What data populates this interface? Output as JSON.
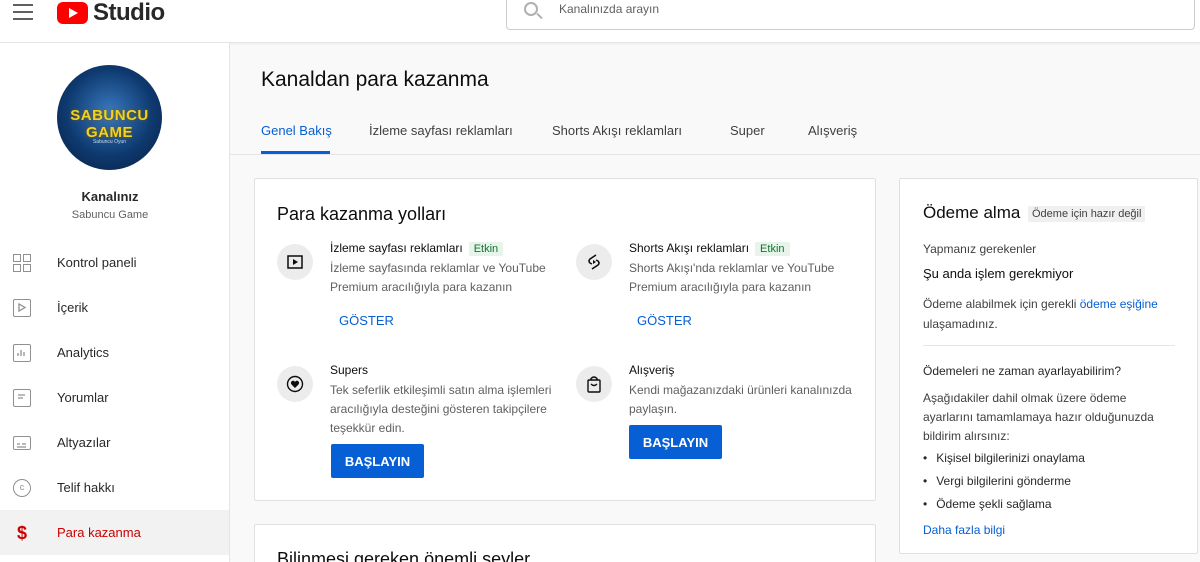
{
  "app": {
    "logo_text": "Studio"
  },
  "search": {
    "placeholder": "Kanalınızda arayın"
  },
  "channel": {
    "label": "Kanalınız",
    "name": "Sabuncu Game",
    "avatar_text": "SABUNCU GAME",
    "avatar_sub": "Sabuncu Oyun"
  },
  "sidebar": {
    "items": [
      {
        "label": "Kontrol paneli",
        "icon": "dashboard-icon"
      },
      {
        "label": "İçerik",
        "icon": "content-icon"
      },
      {
        "label": "Analytics",
        "icon": "analytics-icon"
      },
      {
        "label": "Yorumlar",
        "icon": "comments-icon"
      },
      {
        "label": "Altyazılar",
        "icon": "subtitles-icon"
      },
      {
        "label": "Telif hakkı",
        "icon": "copyright-icon"
      },
      {
        "label": "Para kazanma",
        "icon": "dollar-icon",
        "active": true
      }
    ]
  },
  "main": {
    "title": "Kanaldan para kazanma",
    "tabs": [
      {
        "label": "Genel Bakış",
        "active": true
      },
      {
        "label": "İzleme sayfası reklamları"
      },
      {
        "label": "Shorts Akışı reklamları"
      },
      {
        "label": "Super"
      },
      {
        "label": "Alışveriş"
      }
    ]
  },
  "ways": {
    "title": "Para kazanma yolları",
    "items": [
      {
        "title": "İzleme sayfası reklamları",
        "badge": "Etkin",
        "desc": "İzleme sayfasında reklamlar ve YouTube Premium aracılığıyla para kazanın",
        "action": "GÖSTER",
        "icon": "play-box-icon"
      },
      {
        "title": "Shorts Akışı reklamları",
        "badge": "Etkin",
        "desc": "Shorts Akışı'nda reklamlar ve YouTube Premium aracılığıyla para kazanın",
        "action": "GÖSTER",
        "icon": "shorts-icon"
      },
      {
        "title": "Supers",
        "desc": "Tek seferlik etkileşimli satın alma işlemleri aracılığıyla desteğini gösteren takipçilere teşekkür edin.",
        "action": "BAŞLAYIN",
        "icon": "supers-heart-icon"
      },
      {
        "title": "Alışveriş",
        "desc": "Kendi mağazanızdaki ürünleri kanalınızda paylaşın.",
        "action": "BAŞLAYIN",
        "icon": "shopping-bag-icon"
      }
    ]
  },
  "second_card": {
    "title_partial": "Bilinmesi gereken önemli şeyler"
  },
  "payment": {
    "title": "Ödeme alma",
    "status_badge": "Ödeme için hazır değil",
    "todo_label": "Yapmanız gerekenler",
    "todo_value": "Şu anda işlem gerekmiyor",
    "threshold_text_before": "Ödeme alabilmek için gerekli ",
    "threshold_link": "ödeme eşiğine",
    "threshold_text_after": "ulaşamadınız.",
    "question": "Ödemeleri ne zaman ayarlayabilirim?",
    "explain": "Aşağıdakiler dahil olmak üzere ödeme ayarlarını tamamlamaya hazır olduğunuzda bildirim alırsınız:",
    "bullets": [
      "Kişisel bilgilerinizi onaylama",
      "Vergi bilgilerini gönderme",
      "Ödeme şekli sağlama"
    ],
    "more_link": "Daha fazla bilgi"
  }
}
